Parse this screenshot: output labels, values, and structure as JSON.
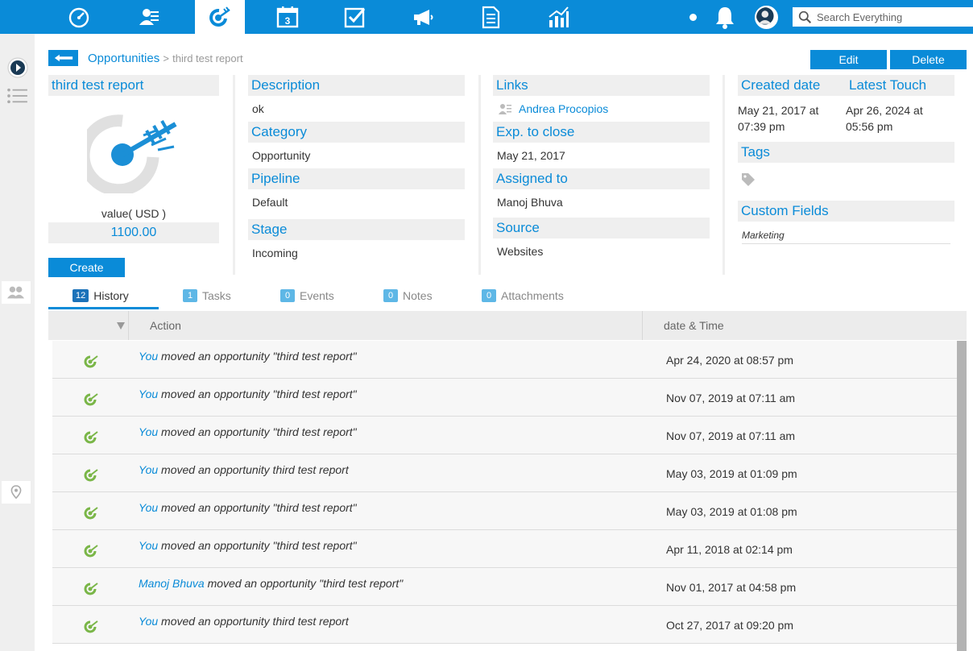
{
  "nav": {
    "items": [
      {
        "name": "dashboard",
        "icon": "speedometer-icon"
      },
      {
        "name": "contacts",
        "icon": "contacts-icon"
      },
      {
        "name": "deals",
        "icon": "target-icon",
        "active": true
      },
      {
        "name": "calendar",
        "icon": "calendar-icon",
        "day": "3"
      },
      {
        "name": "tasks",
        "icon": "checkbox-icon"
      },
      {
        "name": "campaigns",
        "icon": "megaphone-icon"
      },
      {
        "name": "documents",
        "icon": "document-icon"
      },
      {
        "name": "reports",
        "icon": "chart-icon"
      }
    ],
    "search_placeholder": "Search Everything"
  },
  "breadcrumb": {
    "parent": "Opportunities",
    "separator": ">",
    "current": "third test report"
  },
  "actions": {
    "edit": "Edit",
    "delete": "Delete"
  },
  "deal": {
    "name": "third test report",
    "value_label": "value( USD )",
    "value": "1100.00",
    "create_label": "Create"
  },
  "details": {
    "description": {
      "label": "Description",
      "value": "ok"
    },
    "category": {
      "label": "Category",
      "value": "Opportunity"
    },
    "pipeline": {
      "label": "Pipeline",
      "value": "Default"
    },
    "stage": {
      "label": "Stage",
      "value": "Incoming"
    },
    "links": {
      "label": "Links",
      "value": "Andrea Procopios"
    },
    "close": {
      "label": "Exp. to close",
      "value": "May 21, 2017"
    },
    "assigned": {
      "label": "Assigned to",
      "value": "Manoj Bhuva"
    },
    "source": {
      "label": "Source",
      "value": "Websites"
    },
    "created": {
      "label": "Created date",
      "line1": "May 21, 2017 at",
      "line2": "07:39 pm"
    },
    "latest": {
      "label": "Latest Touch",
      "line1": "Apr 26, 2024 at",
      "line2": "05:56 pm"
    },
    "tags": {
      "label": "Tags"
    },
    "custom": {
      "label": "Custom Fields",
      "value": "Marketing"
    }
  },
  "tabs": [
    {
      "label": "History",
      "count": "12",
      "active": true
    },
    {
      "label": "Tasks",
      "count": "1"
    },
    {
      "label": "Events",
      "count": "0"
    },
    {
      "label": "Notes",
      "count": "0"
    },
    {
      "label": "Attachments",
      "count": "0"
    }
  ],
  "table": {
    "headers": {
      "action": "Action",
      "datetime": "date & Time"
    },
    "rows": [
      {
        "who": "You",
        "text": " moved an opportunity \"third test report\"",
        "when": "Apr 24, 2020 at 08:57 pm"
      },
      {
        "who": "You",
        "text": " moved an opportunity \"third test report\"",
        "when": "Nov 07, 2019 at 07:11 am"
      },
      {
        "who": "You",
        "text": " moved an opportunity \"third test report\"",
        "when": "Nov 07, 2019 at 07:11 am"
      },
      {
        "who": "You",
        "text": " moved an opportunity third test report",
        "when": "May 03, 2019 at 01:09 pm"
      },
      {
        "who": "You",
        "text": " moved an opportunity \"third test report\"",
        "when": "May 03, 2019 at 01:08 pm"
      },
      {
        "who": "You",
        "text": " moved an opportunity \"third test report\"",
        "when": "Apr 11, 2018 at 02:14 pm"
      },
      {
        "who": "Manoj Bhuva",
        "text": " moved an opportunity \"third test report\"",
        "when": "Nov 01, 2017 at 04:58 pm"
      },
      {
        "who": "You",
        "text": " moved an opportunity third test report",
        "when": "Oct 27, 2017 at 09:20 pm"
      }
    ]
  },
  "colors": {
    "accent": "#0a8bd8",
    "panel": "#efefef",
    "row_icon": "#7ab648"
  }
}
